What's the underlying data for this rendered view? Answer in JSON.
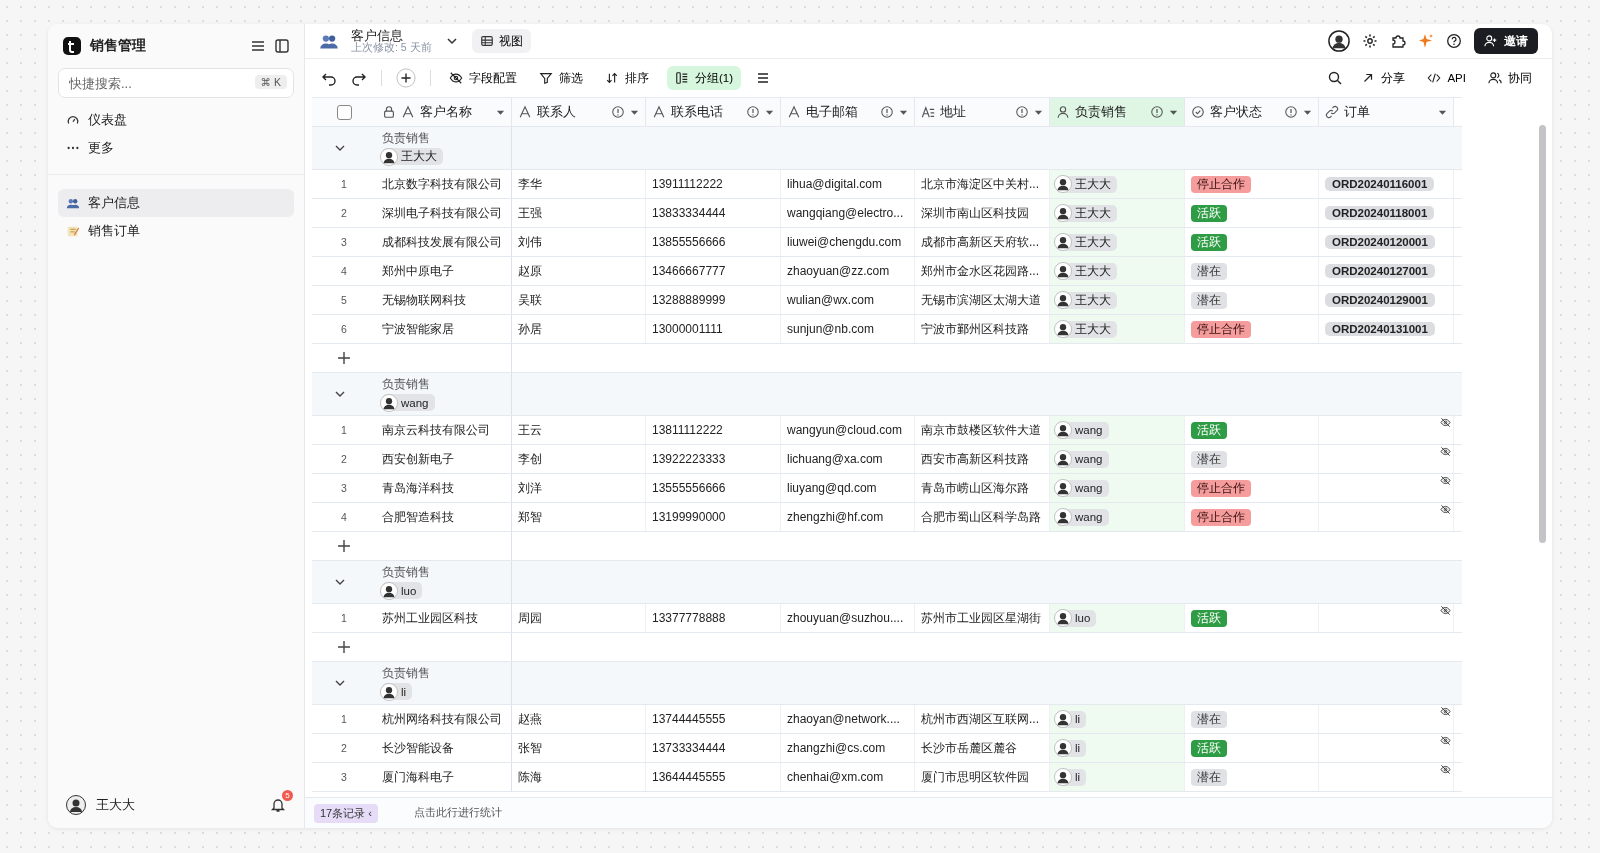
{
  "sidebar": {
    "app_title": "销售管理",
    "search": {
      "placeholder": "快捷搜索...",
      "shortcut": "⌘ K"
    },
    "nav": [
      {
        "label": "仪表盘",
        "kind": "dashboard"
      },
      {
        "label": "更多",
        "kind": "more"
      }
    ],
    "tables": [
      {
        "label": "客户信息",
        "selected": true,
        "kind": "people"
      },
      {
        "label": "销售订单",
        "selected": false,
        "kind": "memo"
      }
    ],
    "user": {
      "name": "王大大",
      "notifications": "5"
    }
  },
  "header": {
    "title": "客户信息",
    "modified_label": "上次修改:",
    "modified": "5 天前",
    "view_button": "视图",
    "invite_button": "邀请"
  },
  "toolbar": {
    "field_config": "字段配置",
    "filter": "筛选",
    "sort": "排序",
    "group": "分组(1)",
    "group_active": true,
    "share": "分享",
    "api": "API",
    "collab": "协同"
  },
  "table": {
    "select_all": {
      "checked": false
    },
    "columns": [
      {
        "label": "客户名称",
        "kind": "primary",
        "selected": false
      },
      {
        "label": "联系人",
        "kind": "text",
        "selected": false
      },
      {
        "label": "联系电话",
        "kind": "text",
        "selected": false
      },
      {
        "label": "电子邮箱",
        "kind": "text",
        "selected": false
      },
      {
        "label": "地址",
        "kind": "longtext",
        "selected": false
      },
      {
        "label": "负责销售",
        "kind": "user",
        "selected": true
      },
      {
        "label": "客户状态",
        "kind": "status",
        "selected": false
      },
      {
        "label": "订单",
        "kind": "link",
        "selected": false
      }
    ],
    "groups": [
      {
        "field": "负责销售",
        "owner": "王大大",
        "rows": [
          {
            "index": "1",
            "name": "北京数字科技有限公司",
            "contact": "李华",
            "phone": "13911112222",
            "email": "lihua@digital.com",
            "address": "北京市海淀区中关村...",
            "sales": "王大大",
            "status": {
              "label": "停止合作",
              "kind": "stopped"
            },
            "order": "ORD20240116001"
          },
          {
            "index": "2",
            "name": "深圳电子科技有限公司",
            "contact": "王强",
            "phone": "13833334444",
            "email": "wangqiang@electro...",
            "address": "深圳市南山区科技园",
            "sales": "王大大",
            "status": {
              "label": "活跃",
              "kind": "active"
            },
            "order": "ORD20240118001"
          },
          {
            "index": "3",
            "name": "成都科技发展有限公司",
            "contact": "刘伟",
            "phone": "13855556666",
            "email": "liuwei@chengdu.com",
            "address": "成都市高新区天府软...",
            "sales": "王大大",
            "status": {
              "label": "活跃",
              "kind": "active"
            },
            "order": "ORD20240120001"
          },
          {
            "index": "4",
            "name": "郑州中原电子",
            "contact": "赵原",
            "phone": "13466667777",
            "email": "zhaoyuan@zz.com",
            "address": "郑州市金水区花园路...",
            "sales": "王大大",
            "status": {
              "label": "潜在",
              "kind": "potential"
            },
            "order": "ORD20240127001"
          },
          {
            "index": "5",
            "name": "无锡物联网科技",
            "contact": "吴联",
            "phone": "13288889999",
            "email": "wulian@wx.com",
            "address": "无锡市滨湖区太湖大道",
            "sales": "王大大",
            "status": {
              "label": "潜在",
              "kind": "potential"
            },
            "order": "ORD20240129001"
          },
          {
            "index": "6",
            "name": "宁波智能家居",
            "contact": "孙居",
            "phone": "13000001111",
            "email": "sunjun@nb.com",
            "address": "宁波市鄞州区科技路",
            "sales": "王大大",
            "status": {
              "label": "停止合作",
              "kind": "stopped"
            },
            "order": "ORD20240131001"
          }
        ]
      },
      {
        "field": "负责销售",
        "owner": "wang",
        "rows": [
          {
            "index": "1",
            "name": "南京云科技有限公司",
            "contact": "王云",
            "phone": "13811112222",
            "email": "wangyun@cloud.com",
            "address": "南京市鼓楼区软件大道",
            "sales": "wang",
            "status": {
              "label": "活跃",
              "kind": "active"
            }
          },
          {
            "index": "2",
            "name": "西安创新电子",
            "contact": "李创",
            "phone": "13922223333",
            "email": "lichuang@xa.com",
            "address": "西安市高新区科技路",
            "sales": "wang",
            "status": {
              "label": "潜在",
              "kind": "potential"
            }
          },
          {
            "index": "3",
            "name": "青岛海洋科技",
            "contact": "刘洋",
            "phone": "13555556666",
            "email": "liuyang@qd.com",
            "address": "青岛市崂山区海尔路",
            "sales": "wang",
            "status": {
              "label": "停止合作",
              "kind": "stopped"
            }
          },
          {
            "index": "4",
            "name": "合肥智造科技",
            "contact": "郑智",
            "phone": "13199990000",
            "email": "zhengzhi@hf.com",
            "address": "合肥市蜀山区科学岛路",
            "sales": "wang",
            "status": {
              "label": "停止合作",
              "kind": "stopped"
            }
          }
        ]
      },
      {
        "field": "负责销售",
        "owner": "luo",
        "rows": [
          {
            "index": "1",
            "name": "苏州工业园区科技",
            "contact": "周园",
            "phone": "13377778888",
            "email": "zhouyuan@suzhou....",
            "address": "苏州市工业园区星湖街",
            "sales": "luo",
            "status": {
              "label": "活跃",
              "kind": "active"
            }
          }
        ]
      },
      {
        "field": "负责销售",
        "owner": "li",
        "rows": [
          {
            "index": "1",
            "name": "杭州网络科技有限公司",
            "contact": "赵燕",
            "phone": "13744445555",
            "email": "zhaoyan@network....",
            "address": "杭州市西湖区互联网...",
            "sales": "li",
            "status": {
              "label": "潜在",
              "kind": "potential"
            }
          },
          {
            "index": "2",
            "name": "长沙智能设备",
            "contact": "张智",
            "phone": "13733334444",
            "email": "zhangzhi@cs.com",
            "address": "长沙市岳麓区麓谷",
            "sales": "li",
            "status": {
              "label": "活跃",
              "kind": "active"
            }
          },
          {
            "index": "3",
            "name": "厦门海科电子",
            "contact": "陈海",
            "phone": "13644445555",
            "email": "chenhai@xm.com",
            "address": "厦门市思明区软件园",
            "sales": "li",
            "status": {
              "label": "潜在",
              "kind": "potential"
            }
          }
        ]
      }
    ]
  },
  "footer": {
    "records": "17条记录",
    "collapse": "‹",
    "stats_hint": "点击此行进行统计"
  }
}
